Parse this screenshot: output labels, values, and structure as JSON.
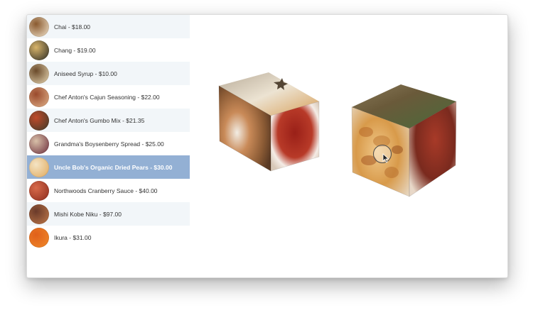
{
  "products": [
    {
      "label": "Chai - $18.00",
      "icon": "chai-thumbnail-icon",
      "colors": [
        "#f3e6cf",
        "#8a5a2f"
      ]
    },
    {
      "label": "Chang - $19.00",
      "icon": "chang-thumbnail-icon",
      "colors": [
        "#2a2a24",
        "#d8b46a"
      ]
    },
    {
      "label": "Aniseed Syrup - $10.00",
      "icon": "aniseed-syrup-thumbnail-icon",
      "colors": [
        "#e9d9b5",
        "#6a4a2a"
      ]
    },
    {
      "label": "Chef Anton's Cajun Seasoning - $22.00",
      "icon": "cajun-seasoning-thumbnail-icon",
      "colors": [
        "#e2b48c",
        "#9a4a2c"
      ]
    },
    {
      "label": "Chef Anton's Gumbo Mix - $21.35",
      "icon": "gumbo-mix-thumbnail-icon",
      "colors": [
        "#3a3a2a",
        "#c04a2a"
      ]
    },
    {
      "label": "Grandma's Boysenberry Spread - $25.00",
      "icon": "boysenberry-spread-thumbnail-icon",
      "colors": [
        "#6a2a3a",
        "#d8c0a8"
      ]
    },
    {
      "label": "Uncle Bob's Organic Dried Pears - $30.00",
      "icon": "dried-pears-thumbnail-icon",
      "colors": [
        "#e0a85a",
        "#f4e4c4"
      ],
      "selected": true
    },
    {
      "label": "Northwoods Cranberry Sauce - $40.00",
      "icon": "cranberry-sauce-thumbnail-icon",
      "colors": [
        "#8a2a1c",
        "#d86a4a"
      ]
    },
    {
      "label": "Mishi Kobe Niku - $97.00",
      "icon": "kobe-niku-thumbnail-icon",
      "colors": [
        "#c07a4a",
        "#6a3a2a"
      ]
    },
    {
      "label": "Ikura - $31.00",
      "icon": "ikura-thumbnail-icon",
      "colors": [
        "#f08a2a",
        "#e0601a"
      ]
    }
  ]
}
